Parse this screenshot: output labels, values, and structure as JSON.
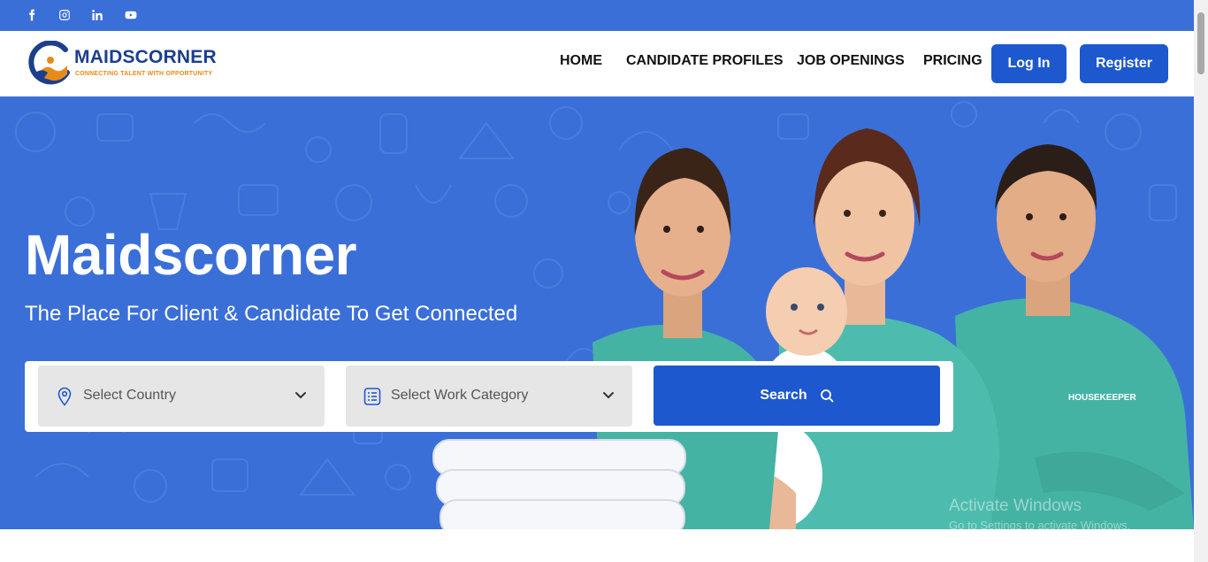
{
  "social": {
    "items": [
      {
        "name": "facebook-icon"
      },
      {
        "name": "instagram-icon"
      },
      {
        "name": "linkedin-icon"
      },
      {
        "name": "youtube-icon"
      }
    ]
  },
  "brand": {
    "name": "MAIDSCORNER",
    "tagline": "CONNECTING TALENT WITH OPPORTUNITY"
  },
  "nav": {
    "home": "HOME",
    "candidate_profiles": "CANDIDATE PROFILES",
    "job_openings": "JOB OPENINGS",
    "pricing": "PRICING",
    "login": "Log In",
    "register": "Register"
  },
  "hero": {
    "title": "Maidscorner",
    "subtitle": "The Place For Client & Candidate To Get Connected",
    "uniform_badge": "HOUSEKEEPER"
  },
  "search": {
    "country_placeholder": "Select Country",
    "category_placeholder": "Select Work Category",
    "button_label": "Search"
  },
  "watermark": {
    "line1": "Activate Windows",
    "line2": "Go to Settings to activate Windows."
  },
  "colors": {
    "brand_blue": "#1d58cf",
    "hero_blue": "#3a6fd8",
    "logo_navy": "#1c3f8c",
    "logo_orange": "#e88a1a",
    "scrub_teal": "#45b3a4"
  }
}
